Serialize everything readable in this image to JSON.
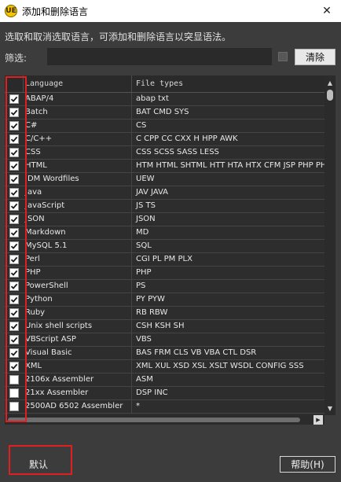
{
  "window": {
    "title": "添加和删除语言",
    "close_glyph": "✕",
    "app_icon_text": "UE"
  },
  "description": "选取和取消选取语言，可添加和删除语言以突显语法。",
  "filter": {
    "label": "筛选:",
    "value": "",
    "placeholder": "",
    "checkbox_checked": false,
    "clear_label": "清除"
  },
  "table": {
    "headers": {
      "language": "Language",
      "file_types": "File types"
    },
    "rows": [
      {
        "checked": true,
        "language": "ABAP/4",
        "types": "abap txt"
      },
      {
        "checked": true,
        "language": "Batch",
        "types": "BAT CMD SYS"
      },
      {
        "checked": true,
        "language": "C#",
        "types": "CS"
      },
      {
        "checked": true,
        "language": "C/C++",
        "types": "C CPP CC CXX H HPP AWK"
      },
      {
        "checked": true,
        "language": "CSS",
        "types": "CSS SCSS SASS LESS"
      },
      {
        "checked": true,
        "language": "HTML",
        "types": "HTM HTML SHTML HTT HTA HTX CFM JSP PHP PH."
      },
      {
        "checked": true,
        "language": "IDM Wordfiles",
        "types": "UEW"
      },
      {
        "checked": true,
        "language": "Java",
        "types": "JAV JAVA"
      },
      {
        "checked": true,
        "language": "JavaScript",
        "types": "JS TS"
      },
      {
        "checked": true,
        "language": "JSON",
        "types": "JSON"
      },
      {
        "checked": true,
        "language": "Markdown",
        "types": "MD"
      },
      {
        "checked": true,
        "language": "MySQL 5.1",
        "types": "SQL"
      },
      {
        "checked": true,
        "language": "Perl",
        "types": "CGI PL PM PLX"
      },
      {
        "checked": true,
        "language": "PHP",
        "types": "PHP"
      },
      {
        "checked": true,
        "language": "PowerShell",
        "types": "PS"
      },
      {
        "checked": true,
        "language": "Python",
        "types": "PY PYW"
      },
      {
        "checked": true,
        "language": "Ruby",
        "types": "RB RBW"
      },
      {
        "checked": true,
        "language": "Unix shell scripts",
        "types": "CSH KSH SH"
      },
      {
        "checked": true,
        "language": "VBScript ASP",
        "types": "VBS"
      },
      {
        "checked": true,
        "language": "Visual Basic",
        "types": "BAS FRM CLS VB VBA CTL DSR"
      },
      {
        "checked": true,
        "language": "XML",
        "types": "XML XUL XSD XSL XSLT WSDL CONFIG SSS"
      },
      {
        "checked": false,
        "language": "2106x Assembler",
        "types": "ASM"
      },
      {
        "checked": false,
        "language": "21xx Assembler",
        "types": "DSP INC"
      },
      {
        "checked": false,
        "language": "2500AD 6502 Assembler",
        "types": "*"
      }
    ]
  },
  "buttons": {
    "default_label": "默认",
    "help_label": "帮助(H)"
  },
  "colors": {
    "highlight": "#e02020",
    "background": "#3c3c3c"
  }
}
